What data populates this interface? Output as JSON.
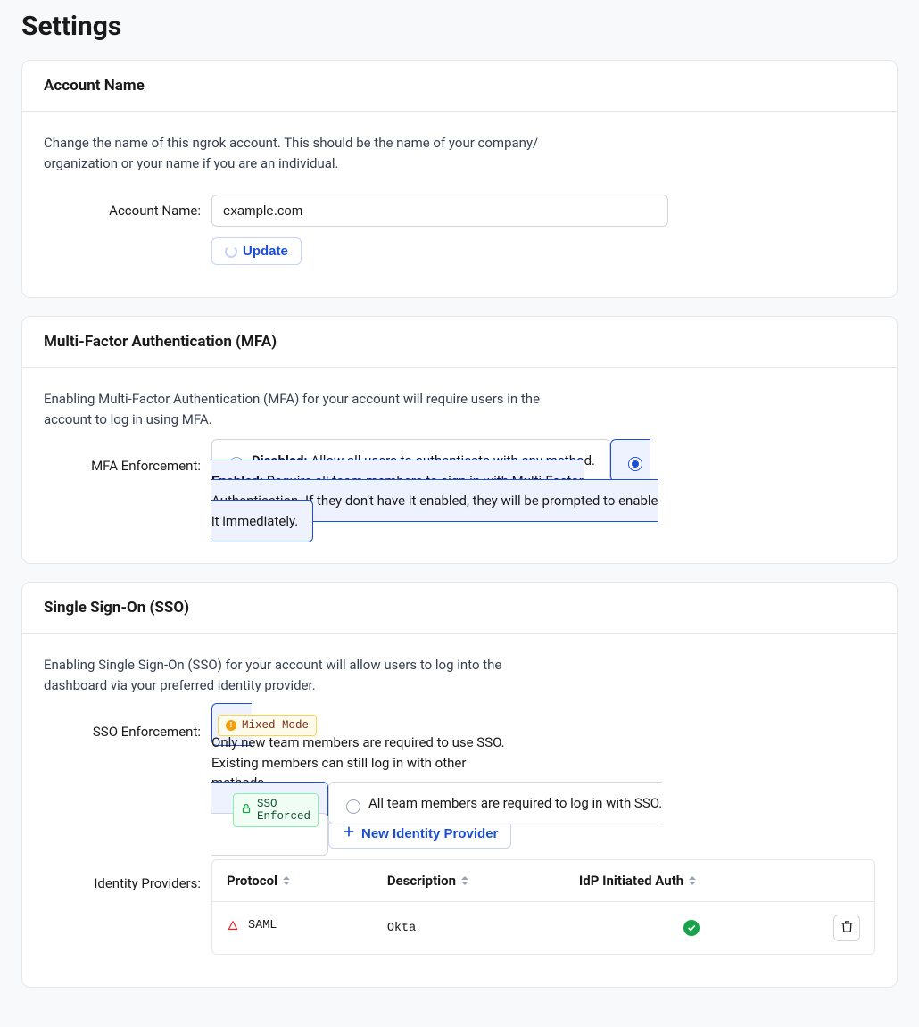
{
  "page_title": "Settings",
  "account_name": {
    "card_title": "Account Name",
    "description": "Change the name of this ngrok account. This should be the name of your company/ organization or your name if you are an individual.",
    "label": "Account Name:",
    "value": "example.com",
    "update_label": "Update"
  },
  "mfa": {
    "card_title": "Multi-Factor Authentication (MFA)",
    "description": "Enabling Multi-Factor Authentication (MFA) for your account will require users in the account to log in using MFA.",
    "label": "MFA Enforcement:",
    "options": [
      {
        "id": "disabled",
        "bold": "Disabled:",
        "text": " Allow all users to authenticate with any method.",
        "selected": false
      },
      {
        "id": "enabled",
        "bold": "Enabled:",
        "text": " Require all team members to sign in with Multi-Factor Authentication. If they don't have it enabled, they will be prompted to enable it immediately.",
        "selected": true
      }
    ]
  },
  "sso": {
    "card_title": "Single Sign-On (SSO)",
    "description": "Enabling Single Sign-On (SSO) for your account will allow users to log into the dashboard via your preferred identity provider.",
    "enforcement_label": "SSO Enforcement:",
    "options": [
      {
        "id": "mixed",
        "text": "Only new team members are required to use SSO. Existing members can still log in with other methods.",
        "selected": true,
        "badge": "Mixed Mode",
        "badge_type": "mixed"
      },
      {
        "id": "enforced",
        "text": "All team members are required to log in with SSO.",
        "selected": false,
        "badge": "SSO Enforced",
        "badge_type": "enforced"
      }
    ],
    "new_provider_label": "New Identity Provider",
    "providers_label": "Identity Providers:",
    "table": {
      "columns": [
        "Protocol",
        "Description",
        "IdP Initiated Auth"
      ],
      "rows": [
        {
          "protocol": "SAML",
          "description": "Okta",
          "idp_initiated": true
        }
      ]
    }
  }
}
